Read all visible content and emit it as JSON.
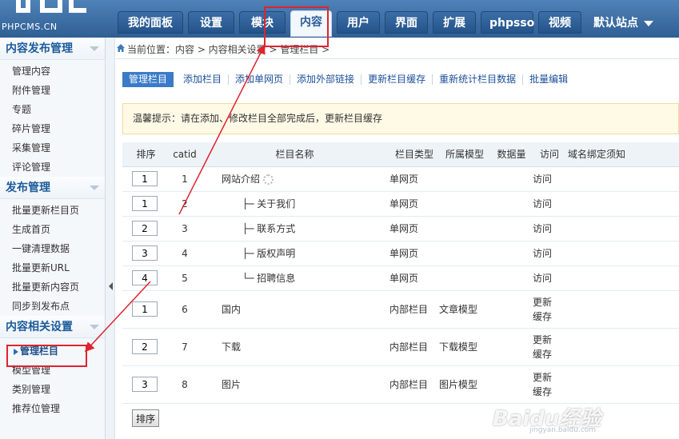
{
  "header": {
    "brand": "PHPCMS.CN",
    "tabs": [
      "我的面板",
      "设置",
      "模块",
      "内容",
      "用户",
      "界面",
      "扩展",
      "phpsso",
      "视频"
    ],
    "active_tab": "内容",
    "site_switch": "默认站点"
  },
  "sidebar": {
    "groups": [
      {
        "title": "内容发布管理",
        "items": [
          "管理内容",
          "附件管理",
          "专题",
          "碎片管理",
          "采集管理",
          "评论管理"
        ]
      },
      {
        "title": "发布管理",
        "items": [
          "批量更新栏目页",
          "生成首页",
          "一键清理数据",
          "批量更新URL",
          "批量更新内容页",
          "同步到发布点"
        ]
      },
      {
        "title": "内容相关设置",
        "items": [
          "管理栏目",
          "模型管理",
          "类别管理",
          "推荐位管理"
        ]
      }
    ],
    "active_item": "管理栏目"
  },
  "breadcrumb": "当前位置：内容 > 内容相关设置 > 管理栏目 >",
  "subnav": [
    "管理栏目",
    "添加栏目",
    "添加单网页",
    "添加外部链接",
    "更新栏目缓存",
    "重新统计栏目数据",
    "批量编辑"
  ],
  "tip": "温馨提示：请在添加、修改栏目全部完成后，更新栏目缓存",
  "table": {
    "headers": [
      "排序",
      "catid",
      "栏目名称",
      "栏目类型",
      "所属模型",
      "数据量",
      "访问",
      "域名绑定须知"
    ],
    "rows": [
      {
        "order": "1",
        "catid": "1",
        "name": "网站介绍",
        "type": "单网页",
        "model": "",
        "count": "",
        "visit": "访问",
        "child": false
      },
      {
        "order": "1",
        "catid": "2",
        "name": "├─ 关于我们",
        "type": "单网页",
        "model": "",
        "count": "",
        "visit": "访问",
        "child": true
      },
      {
        "order": "2",
        "catid": "3",
        "name": "├─ 联系方式",
        "type": "单网页",
        "model": "",
        "count": "",
        "visit": "访问",
        "child": true
      },
      {
        "order": "3",
        "catid": "4",
        "name": "├─ 版权声明",
        "type": "单网页",
        "model": "",
        "count": "",
        "visit": "访问",
        "child": true
      },
      {
        "order": "4",
        "catid": "5",
        "name": "└─ 招聘信息",
        "type": "单网页",
        "model": "",
        "count": "",
        "visit": "访问",
        "child": true
      },
      {
        "order": "1",
        "catid": "6",
        "name": "国内",
        "type": "内部栏目",
        "model": "文章模型",
        "count": "",
        "visit_lines": [
          "更新",
          "缓存"
        ]
      },
      {
        "order": "2",
        "catid": "7",
        "name": "下载",
        "type": "内部栏目",
        "model": "下载模型",
        "count": "",
        "visit_lines": [
          "更新",
          "缓存"
        ]
      },
      {
        "order": "3",
        "catid": "8",
        "name": "图片",
        "type": "内部栏目",
        "model": "图片模型",
        "count": "",
        "visit_lines": [
          "更新",
          "缓存"
        ]
      }
    ]
  },
  "sort_button": "排序",
  "watermark": {
    "main": "Baidu经验",
    "sub": "jingyan.baidu.com"
  },
  "colors": {
    "header": "#3a6ea5",
    "annotation": "#e0232e",
    "link": "#1d3fa8",
    "warn": "#d8141c"
  }
}
